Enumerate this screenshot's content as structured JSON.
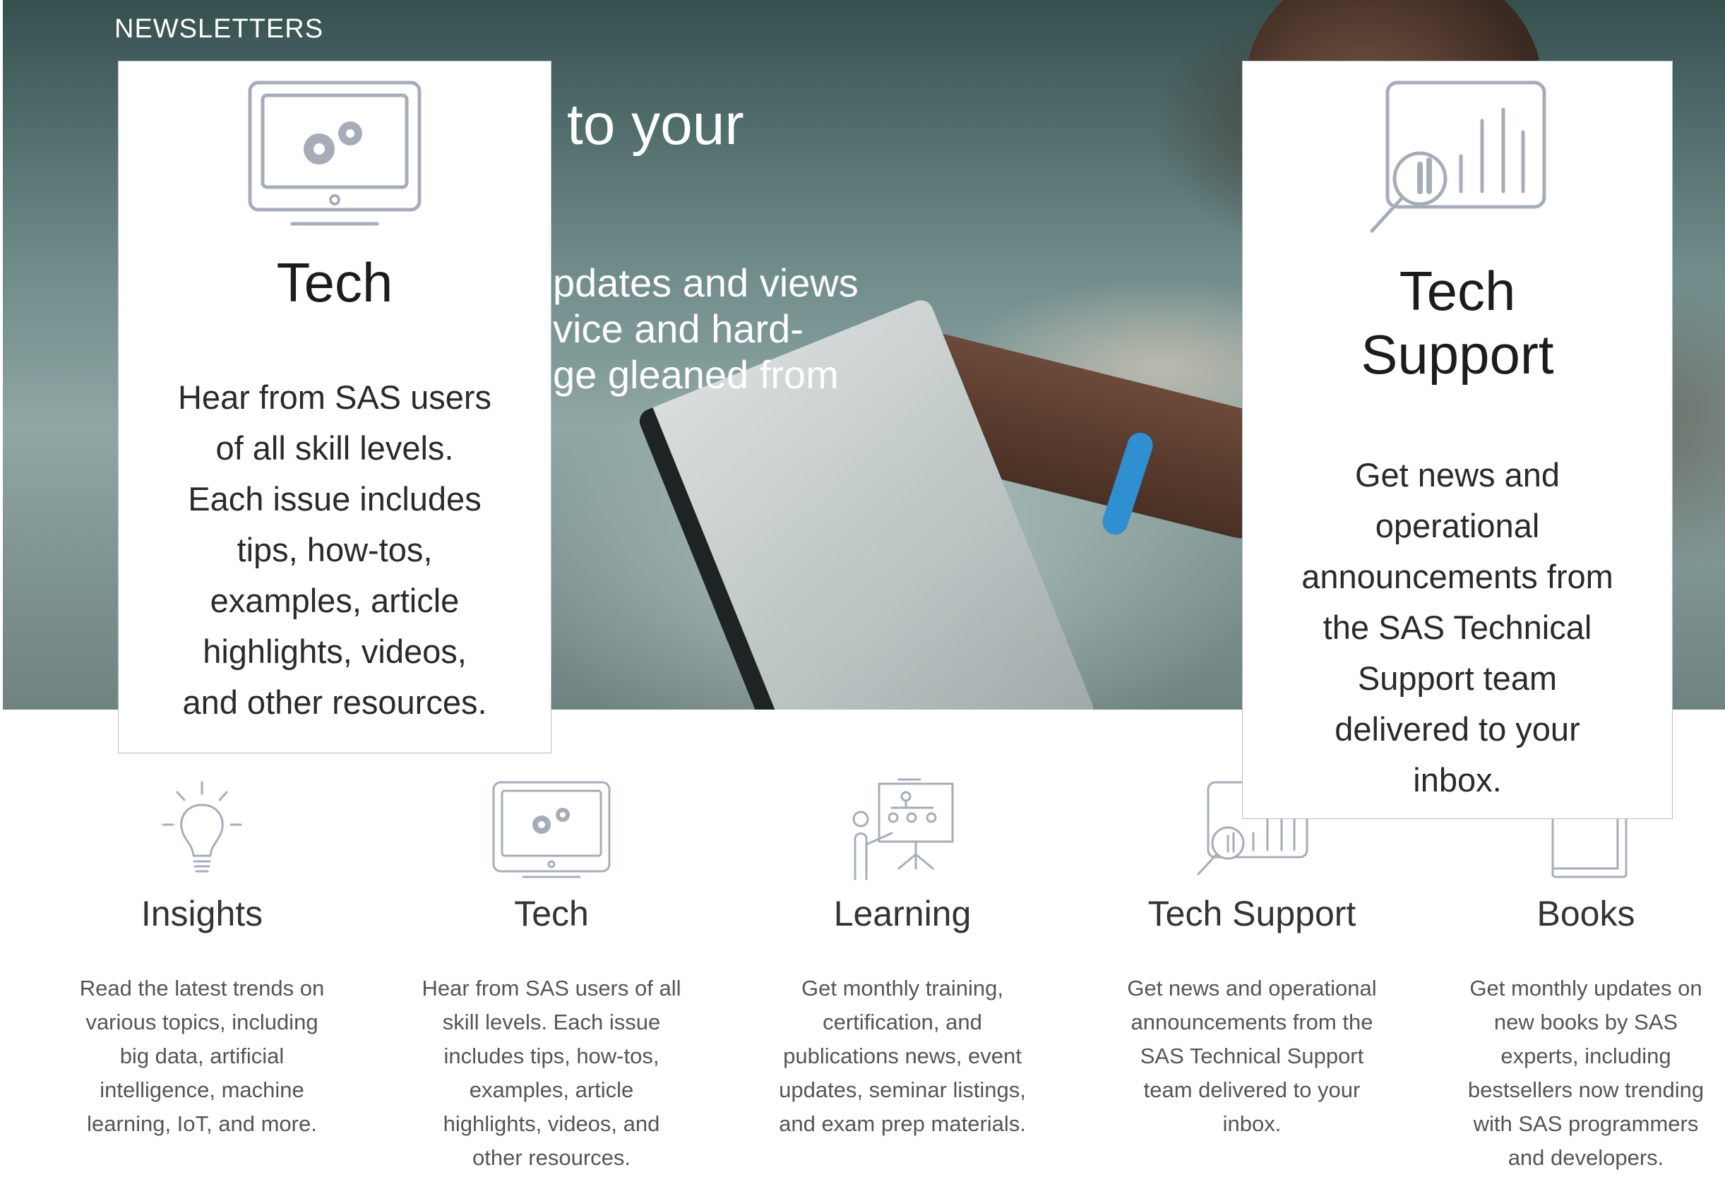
{
  "section_label": "NEWSLETTERS",
  "hero": {
    "heading_fragment": "to your",
    "body_fragments": [
      "pdates and views",
      "vice and hard-",
      "ge gleaned from"
    ]
  },
  "popovers": {
    "tech": {
      "icon": "monitor-gears-icon",
      "title": "Tech",
      "description_lines": [
        "Hear from SAS users",
        "of all skill levels.",
        "Each issue includes",
        "tips, how-tos,",
        "examples, article",
        "highlights, videos,",
        "and other resources."
      ]
    },
    "tech_support": {
      "icon": "analytics-magnifier-icon",
      "title_lines": [
        "Tech",
        "Support"
      ],
      "description_lines": [
        "Get news and",
        "operational",
        "announcements from",
        "the SAS Technical",
        "Support team",
        "delivered to your",
        "inbox."
      ]
    }
  },
  "cards": [
    {
      "icon": "lightbulb-icon",
      "title": "Insights",
      "description_lines": [
        "Read the latest trends on",
        "various topics, including",
        "big data, artificial",
        "intelligence, machine",
        "learning, IoT, and more."
      ]
    },
    {
      "icon": "monitor-gears-icon",
      "title": "Tech",
      "description_lines": [
        "Hear from SAS users of all",
        "skill levels. Each issue",
        "includes tips, how-tos,",
        "examples, article",
        "highlights, videos, and",
        "other resources."
      ]
    },
    {
      "icon": "presenter-board-icon",
      "title": "Learning",
      "description_lines": [
        "Get monthly training,",
        "certification, and",
        "publications news, event",
        "updates, seminar listings,",
        "and exam prep materials."
      ]
    },
    {
      "icon": "analytics-magnifier-icon",
      "title": "Tech Support",
      "description_lines": [
        "Get news and operational",
        "announcements from the",
        "SAS Technical Support",
        "team delivered to your",
        "inbox."
      ]
    },
    {
      "icon": "book-icon",
      "title": "Books",
      "description_lines": [
        "Get monthly updates on",
        "new books by SAS",
        "experts, including",
        "bestsellers now trending",
        "with SAS programmers",
        "and developers."
      ]
    }
  ],
  "colors": {
    "icon_stroke": "#a7adb8",
    "popover_border": "#b8bdc4",
    "hero_teal": "#6b8887"
  }
}
